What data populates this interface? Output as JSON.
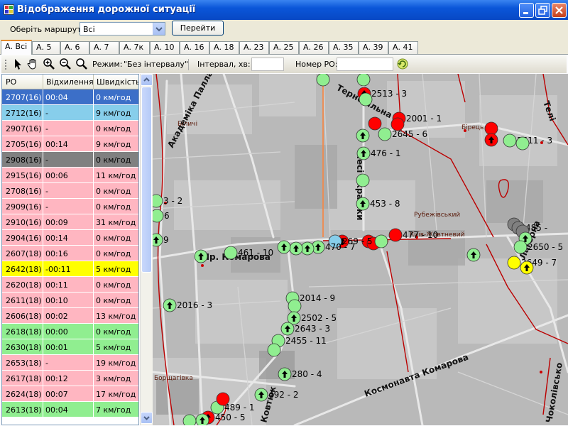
{
  "window": {
    "title": "Відображення дорожної ситуації",
    "colors": {
      "titlebar": "#0a56d9",
      "tab_accent": "#e68b2c"
    }
  },
  "toprow": {
    "route_label": "Оберіть маршрут:",
    "route_value": "Всі",
    "go_button": "Перейти"
  },
  "tabs": [
    "А. Всі",
    "А. 5",
    "А. 6",
    "А. 7",
    "А. 7к",
    "А. 10",
    "А. 16",
    "А. 18",
    "А. 23",
    "А. 25",
    "А. 26",
    "А. 35",
    "А. 39",
    "А. 41"
  ],
  "toolbar": {
    "icons": [
      "pointer-icon",
      "hand-icon",
      "zoom-in-icon",
      "zoom-out-icon",
      "zoom-extent-icon"
    ],
    "mode_label": "Режим:",
    "mode_value": "\"Без інтервалу\"",
    "interval_label": "Інтервал, хв:",
    "interval_value": "",
    "ro_label": "Номер РО:",
    "ro_value": ""
  },
  "table": {
    "columns": [
      "РО",
      "Відхилення",
      "Швидкість"
    ],
    "row_colors": {
      "blue": "#3c6fc8",
      "cyan": "#87ceeb",
      "pink": "#ffb6c1",
      "gray": "#808080",
      "yellow": "#ffff00",
      "green": "#90ee90"
    },
    "rows": [
      {
        "ro": "2707(16)",
        "dev": "00:04",
        "speed": "0 км/год",
        "color": "blue"
      },
      {
        "ro": "2712(16)",
        "dev": "-",
        "speed": "9 км/год",
        "color": "cyan"
      },
      {
        "ro": "2907(16)",
        "dev": "-",
        "speed": "0 км/год",
        "color": "pink"
      },
      {
        "ro": "2705(16)",
        "dev": "00:14",
        "speed": "9 км/год",
        "color": "pink"
      },
      {
        "ro": "2908(16)",
        "dev": "-",
        "speed": "0 км/год",
        "color": "gray"
      },
      {
        "ro": "2915(16)",
        "dev": "00:06",
        "speed": "11 км/год",
        "color": "pink"
      },
      {
        "ro": "2708(16)",
        "dev": "-",
        "speed": "0 км/год",
        "color": "pink"
      },
      {
        "ro": "2909(16)",
        "dev": "-",
        "speed": "0 км/год",
        "color": "pink"
      },
      {
        "ro": "2910(16)",
        "dev": "00:09",
        "speed": "31 км/год",
        "color": "pink"
      },
      {
        "ro": "2904(16)",
        "dev": "00:14",
        "speed": "0 км/год",
        "color": "pink"
      },
      {
        "ro": "2607(18)",
        "dev": "00:16",
        "speed": "0 км/год",
        "color": "pink"
      },
      {
        "ro": "2642(18)",
        "dev": "-00:11",
        "speed": "5 км/год",
        "color": "yellow"
      },
      {
        "ro": "2620(18)",
        "dev": "00:11",
        "speed": "0 км/год",
        "color": "pink"
      },
      {
        "ro": "2611(18)",
        "dev": "00:10",
        "speed": "0 км/год",
        "color": "pink"
      },
      {
        "ro": "2606(18)",
        "dev": "00:02",
        "speed": "13 км/год",
        "color": "pink"
      },
      {
        "ro": "2618(18)",
        "dev": "00:00",
        "speed": "0 км/год",
        "color": "green"
      },
      {
        "ro": "2630(18)",
        "dev": "00:01",
        "speed": "5 км/год",
        "color": "green"
      },
      {
        "ro": "2653(18)",
        "dev": "-",
        "speed": "19 км/год",
        "color": "pink"
      },
      {
        "ro": "2617(18)",
        "dev": "00:12",
        "speed": "3 км/год",
        "color": "pink"
      },
      {
        "ro": "2624(18)",
        "dev": "00:07",
        "speed": "17 км/год",
        "color": "pink"
      },
      {
        "ro": "2613(18)",
        "dev": "00:04",
        "speed": "7 км/год",
        "color": "green"
      }
    ]
  },
  "map": {
    "streets": [
      "Академіка Палладіна",
      "Тернопільна",
      "Лесі Українки",
      "Пр. Комарова",
      "Космонавта Комарова",
      "Чоколівсько",
      "Телі",
      "Ковтюк",
      "Борщагівка",
      "Лагерна"
    ],
    "places": [
      "Біличі",
      "Бірець",
      "Рубежівський",
      "Київ-Жовтневий"
    ],
    "vehicle_colors": {
      "green": "#90ee90",
      "red": "#ff0000",
      "gray": "#808080",
      "yellow": "#ffff00",
      "blue": "#87ceeb"
    },
    "labels": [
      "2513 - 3",
      "2001 - 1",
      "2645 - 6",
      "2511 - 3",
      "476 - 1",
      "453 - 8",
      "485 -",
      "477 - 10",
      "269 - 5",
      "470 - 7",
      "461 - 10",
      "2650 - 5",
      "2649 - 7",
      "2016 - 3",
      "2014 - 9",
      "2502 - 5",
      "2643 - 3",
      "2455 - 11",
      "280 - 4",
      "492 - 2",
      "489 - 1",
      "450 - 5",
      "3 - 2",
      "6",
      "9"
    ]
  }
}
